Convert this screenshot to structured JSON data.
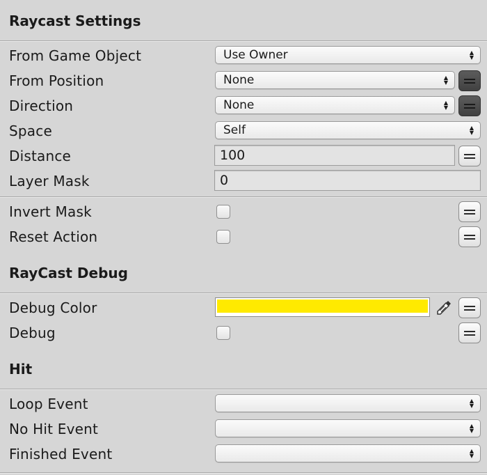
{
  "sections": {
    "raycast_settings": "Raycast Settings",
    "raycast_debug": "RayCast Debug",
    "hit": "Hit"
  },
  "fields": {
    "from_game_object": {
      "label": "From Game Object",
      "value": "Use Owner"
    },
    "from_position": {
      "label": "From Position",
      "value": "None"
    },
    "direction": {
      "label": "Direction",
      "value": "None"
    },
    "space": {
      "label": "Space",
      "value": "Self"
    },
    "distance": {
      "label": "Distance",
      "value": "100"
    },
    "layer_mask": {
      "label": "Layer Mask",
      "value": "0"
    },
    "invert_mask": {
      "label": "Invert Mask",
      "checked": false
    },
    "reset_action": {
      "label": "Reset Action",
      "checked": false
    },
    "debug_color": {
      "label": "Debug Color",
      "color": "#ffea00"
    },
    "debug": {
      "label": "Debug",
      "checked": false
    },
    "loop_event": {
      "label": "Loop Event",
      "value": ""
    },
    "no_hit_event": {
      "label": "No Hit Event",
      "value": ""
    },
    "finished_event": {
      "label": "Finished Event",
      "value": ""
    }
  },
  "icons": {
    "dropdown_arrows": "updown-arrows-icon",
    "variable_toggle": "equals-icon",
    "color_picker": "eyedropper-icon"
  },
  "colors": {
    "background": "#d6d6d6",
    "debug_color": "#ffea00"
  }
}
